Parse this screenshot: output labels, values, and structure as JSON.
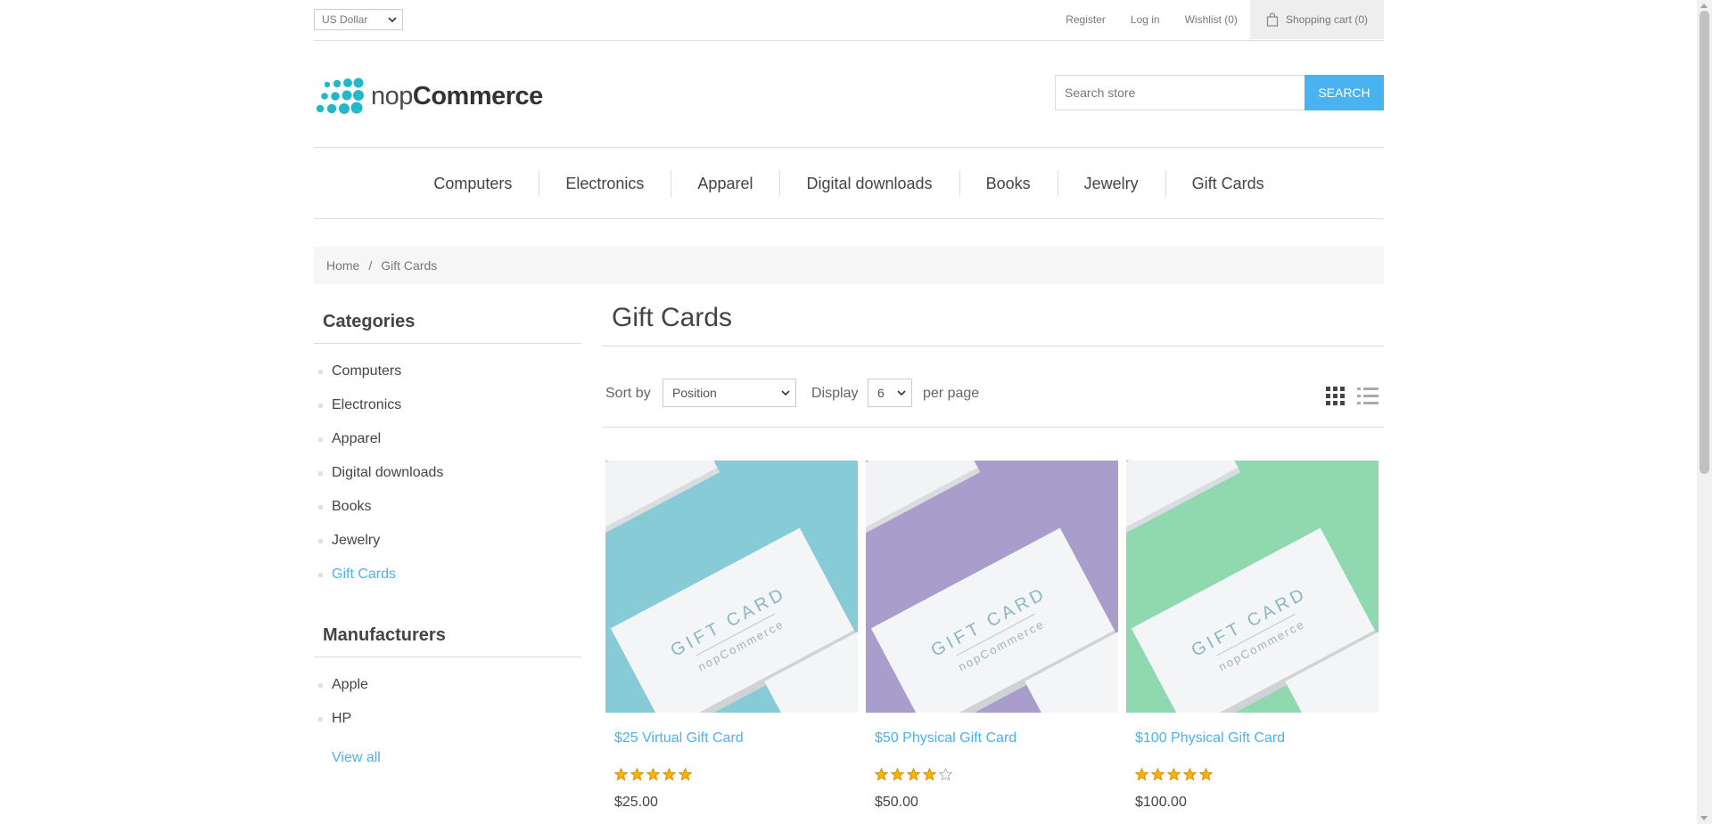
{
  "header": {
    "currency": "US Dollar",
    "links": {
      "register": "Register",
      "login": "Log in",
      "wishlist": "Wishlist (0)",
      "cart": "Shopping cart (0)"
    },
    "logo": {
      "part1": "nop",
      "part2": "Commerce"
    },
    "search": {
      "placeholder": "Search store",
      "button": "SEARCH"
    }
  },
  "menu": [
    "Computers",
    "Electronics",
    "Apparel",
    "Digital downloads",
    "Books",
    "Jewelry",
    "Gift Cards"
  ],
  "breadcrumb": {
    "home": "Home",
    "separator": "/",
    "current": "Gift Cards"
  },
  "sidebar": {
    "categories_title": "Categories",
    "categories": [
      "Computers",
      "Electronics",
      "Apparel",
      "Digital downloads",
      "Books",
      "Jewelry",
      "Gift Cards"
    ],
    "active_category": "Gift Cards",
    "manufacturers_title": "Manufacturers",
    "manufacturers": [
      "Apple",
      "HP"
    ],
    "view_all": "View all"
  },
  "main": {
    "title": "Gift Cards",
    "sort_label": "Sort by",
    "sort_value": "Position",
    "display_label": "Display",
    "display_value": "6",
    "per_page": "per page",
    "products": [
      {
        "title": "$25 Virtual Gift Card",
        "price": "$25.00",
        "rating": 5,
        "bg": "#86cbd6"
      },
      {
        "title": "$50 Physical Gift Card",
        "price": "$50.00",
        "rating": 4,
        "bg": "#a99dcb"
      },
      {
        "title": "$100 Physical Gift Card",
        "price": "$100.00",
        "rating": 5,
        "bg": "#8fd8b0"
      }
    ],
    "card_print": {
      "line1": "GIFT CARD",
      "line2": "nopCommerce"
    }
  },
  "colors": {
    "accent": "#4ab2f1",
    "star": "#f5b400",
    "logo": "#22b8c9"
  }
}
